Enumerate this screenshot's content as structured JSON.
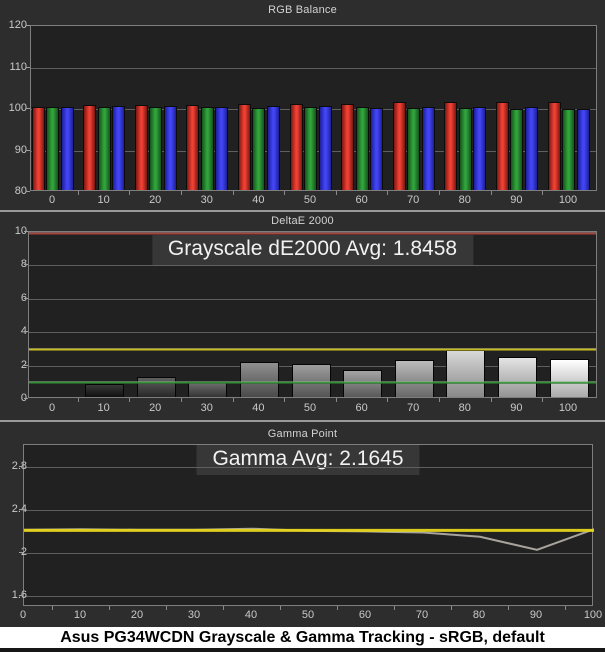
{
  "caption": "Asus PG34WCDN Grayscale & Gamma Tracking - sRGB, default",
  "chart_data": [
    {
      "type": "bar",
      "title": "RGB Balance",
      "categories": [
        0,
        10,
        20,
        30,
        40,
        50,
        60,
        70,
        80,
        90,
        100
      ],
      "series": [
        {
          "name": "Red",
          "color_center": "#ef4134",
          "color_edge": "#7d1710",
          "values": [
            100.1,
            100.4,
            100.6,
            100.5,
            100.8,
            100.8,
            100.8,
            101.1,
            101.1,
            101.2,
            101.1
          ]
        },
        {
          "name": "Green",
          "color_center": "#31a43c",
          "color_edge": "#15541b",
          "values": [
            100.1,
            99.9,
            99.9,
            99.9,
            99.7,
            99.9,
            99.9,
            99.7,
            99.7,
            99.6,
            99.6
          ]
        },
        {
          "name": "Blue",
          "color_center": "#4345f5",
          "color_edge": "#1c2099",
          "values": [
            100.1,
            100.2,
            100.2,
            100.0,
            100.2,
            100.2,
            99.8,
            99.9,
            99.9,
            99.9,
            99.6
          ]
        }
      ],
      "xlabel": "",
      "ylabel": "",
      "ylim": [
        80,
        120
      ],
      "yticks": [
        "120",
        "110",
        "100",
        "90",
        "80"
      ],
      "grid": "on",
      "legend": "none"
    },
    {
      "type": "bar",
      "title": "DeltaE 2000",
      "overlay": "Grayscale dE2000 Avg: 1.8458",
      "average": 1.8458,
      "categories": [
        0,
        10,
        20,
        30,
        40,
        50,
        60,
        70,
        80,
        90,
        100
      ],
      "values": [
        0.05,
        0.8,
        1.2,
        0.9,
        2.1,
        1.95,
        1.6,
        2.2,
        2.8,
        2.4,
        2.25
      ],
      "bar_colors": [
        [
          "#202020",
          "#000000"
        ],
        [
          "#383838",
          "#101010"
        ],
        [
          "#606060",
          "#262626"
        ],
        [
          "#6e6e6e",
          "#333333"
        ],
        [
          "#909090",
          "#4a4a4a"
        ],
        [
          "#9e9e9e",
          "#545454"
        ],
        [
          "#a4a4a4",
          "#585858"
        ],
        [
          "#bcbcbc",
          "#686868"
        ],
        [
          "#d8d8d8",
          "#888888"
        ],
        [
          "#e4e4e4",
          "#949494"
        ],
        [
          "#ffffff",
          "#aaaaaa"
        ]
      ],
      "reference_lines": [
        {
          "name": "max",
          "value": 10,
          "color": "#b04a44"
        },
        {
          "name": "warn",
          "value": 3,
          "color": "#d6cc25"
        },
        {
          "name": "good",
          "value": 1,
          "color": "#3a9a3a"
        }
      ],
      "xlabel": "",
      "ylabel": "",
      "ylim": [
        0,
        10
      ],
      "yticks": [
        "10",
        "8",
        "6",
        "4",
        "2",
        "0"
      ],
      "grid": "on",
      "legend": "none"
    },
    {
      "type": "line",
      "title": "Gamma Point",
      "overlay": "Gamma Avg: 2.1645",
      "average": 2.1645,
      "x": [
        0,
        10,
        20,
        30,
        40,
        50,
        60,
        70,
        80,
        90,
        100
      ],
      "series": [
        {
          "name": "Gamma target",
          "color": "#e6d51c",
          "values": [
            2.21,
            2.21,
            2.21,
            2.21,
            2.21,
            2.21,
            2.21,
            2.21,
            2.21,
            2.21,
            2.21
          ]
        },
        {
          "name": "Measured gamma",
          "color": "#a8a49c",
          "values": [
            2.215,
            2.22,
            2.215,
            2.215,
            2.225,
            2.205,
            2.2,
            2.19,
            2.15,
            2.03,
            2.22
          ]
        }
      ],
      "xlabel": "",
      "ylabel": "",
      "ylim": [
        1.5,
        3.0
      ],
      "yticks": [
        "2.8",
        "2.4",
        "2",
        "1.6"
      ],
      "grid": "on",
      "legend": "none"
    }
  ]
}
